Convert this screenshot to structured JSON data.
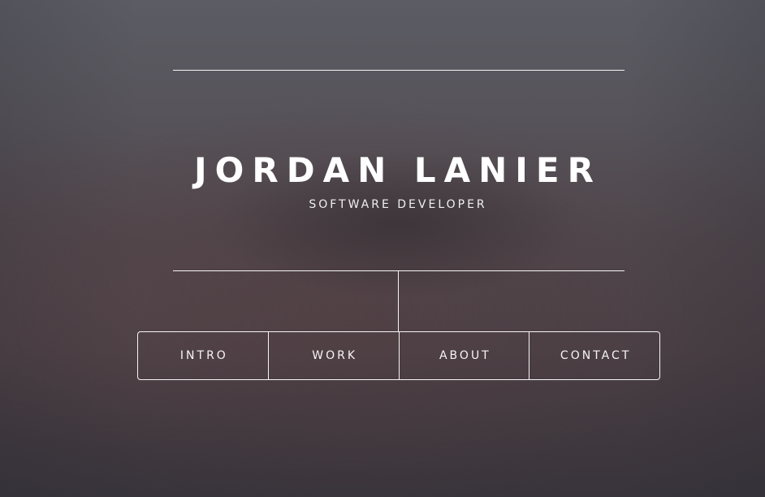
{
  "header": {
    "name": "JORDAN LANIER",
    "tagline": "SOFTWARE DEVELOPER"
  },
  "nav": {
    "items": [
      {
        "label": "INTRO"
      },
      {
        "label": "WORK"
      },
      {
        "label": "ABOUT"
      },
      {
        "label": "CONTACT"
      }
    ]
  }
}
